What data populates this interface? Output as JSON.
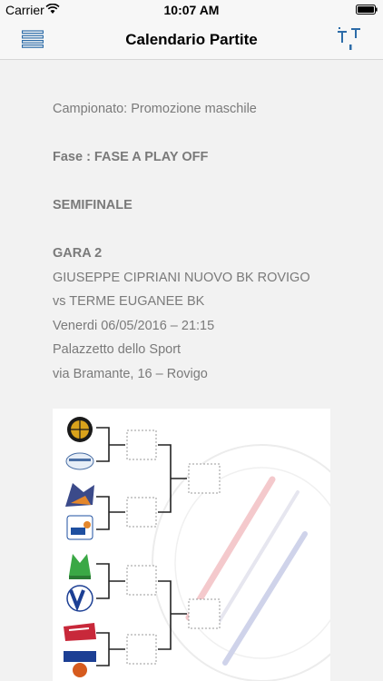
{
  "status_bar": {
    "carrier": "Carrier",
    "time": "10:07 AM"
  },
  "nav": {
    "title": "Calendario Partite"
  },
  "match": {
    "championship": "Campionato: Promozione maschile",
    "phase": "Fase : FASE A PLAY OFF",
    "round": "SEMIFINALE",
    "game": "GARA 2",
    "home_team": "GIUSEPPE CIPRIANI NUOVO BK ROVIGO",
    "away_team": "vs TERME EUGANEE BK",
    "datetime": "Venerdi 06/05/2016 – 21:15",
    "venue": "Palazzetto dello Sport",
    "address": "via Bramante, 16 – Rovigo"
  },
  "bracket": {
    "team_logos": [
      {
        "icon": "basketball-logo",
        "color": "#d9a21b"
      },
      {
        "icon": "rovigo-logo",
        "color": "#4a6fa5"
      },
      {
        "icon": "dragon-logo",
        "color": "#3b4a8a"
      },
      {
        "icon": "basket-lab-logo",
        "color": "#1e4fa0"
      },
      {
        "icon": "motta-logo",
        "color": "#3aa845"
      },
      {
        "icon": "virtus-logo",
        "color": "#1c3f94"
      },
      {
        "icon": "team-red-logo",
        "color": "#c8283a"
      },
      {
        "icon": "marcon-logo",
        "color": "#d65b1e"
      }
    ]
  }
}
